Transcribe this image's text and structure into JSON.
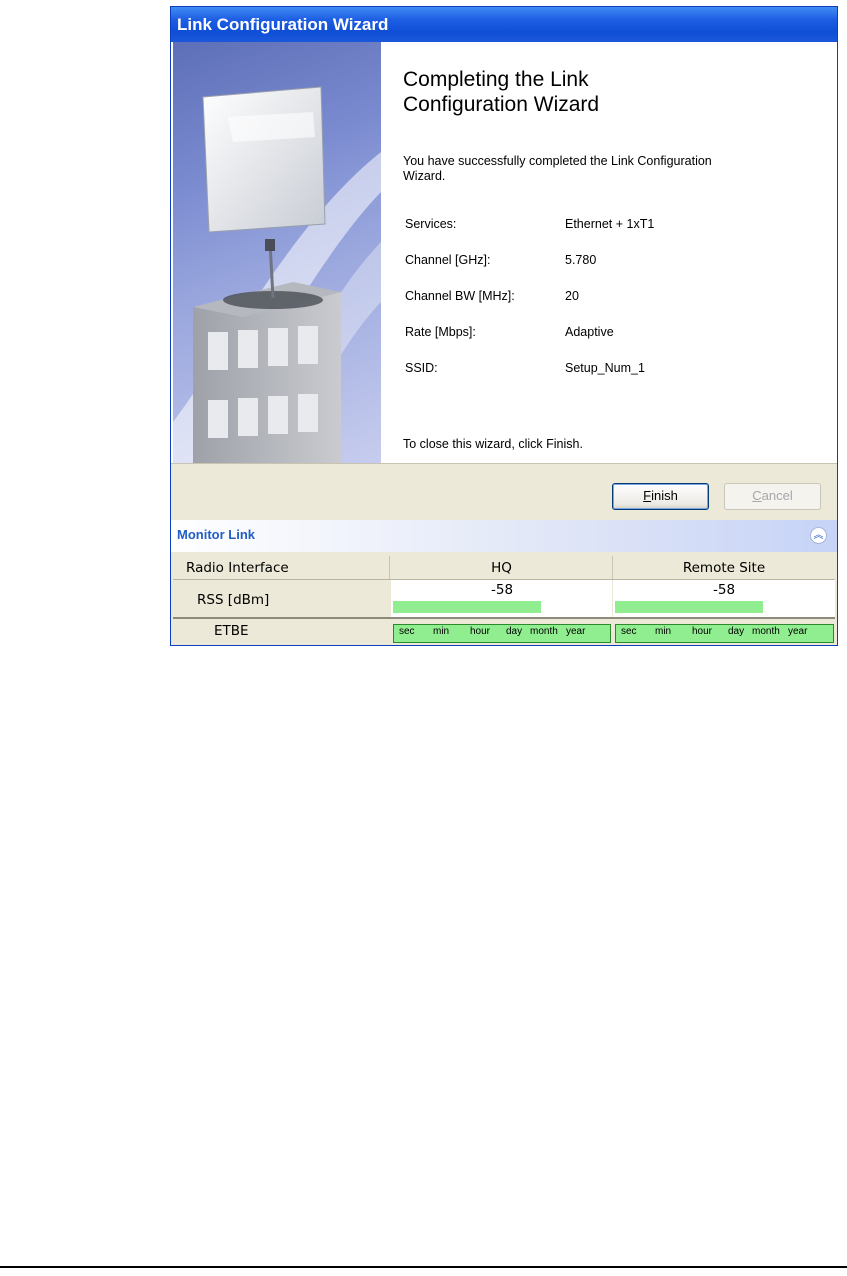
{
  "window": {
    "title": "Link Configuration Wizard"
  },
  "wizard": {
    "heading_line1": "Completing the Link",
    "heading_line2": "Configuration Wizard",
    "intro_line1": "You have successfully completed the Link Configuration",
    "intro_line2": "Wizard.",
    "details": [
      {
        "label": "Services:",
        "value": "Ethernet + 1xT1"
      },
      {
        "label": "Channel [GHz]:",
        "value": "5.780"
      },
      {
        "label": "Channel BW [MHz]:",
        "value": "20"
      },
      {
        "label": "Rate [Mbps]:",
        "value": "Adaptive"
      },
      {
        "label": "SSID:",
        "value": "Setup_Num_1"
      }
    ],
    "closing": "To close this wizard, click Finish."
  },
  "buttons": {
    "finish_mnemonic": "F",
    "finish_rest": "inish",
    "cancel_mnemonic": "C",
    "cancel_rest": "ancel"
  },
  "monitor": {
    "title": "Monitor Link",
    "collapse_icon": "chevron-double-up-icon",
    "columns": [
      "Radio Interface",
      "HQ",
      "Remote Site"
    ],
    "rss_label": "RSS [dBm]",
    "rss_values": {
      "hq": "-58",
      "remote": "-58"
    },
    "rss_level_fraction": {
      "hq": 0.68,
      "remote": 0.68
    },
    "etbe_label": "ETBE",
    "etbe_scale": [
      "sec",
      "min",
      "hour",
      "day",
      "month",
      "year"
    ]
  },
  "colors": {
    "titlebar": "#1f5fe4",
    "accent": "#215dc6",
    "rss_bar": "#90ee90",
    "dialog_bg": "#ece9d8"
  }
}
